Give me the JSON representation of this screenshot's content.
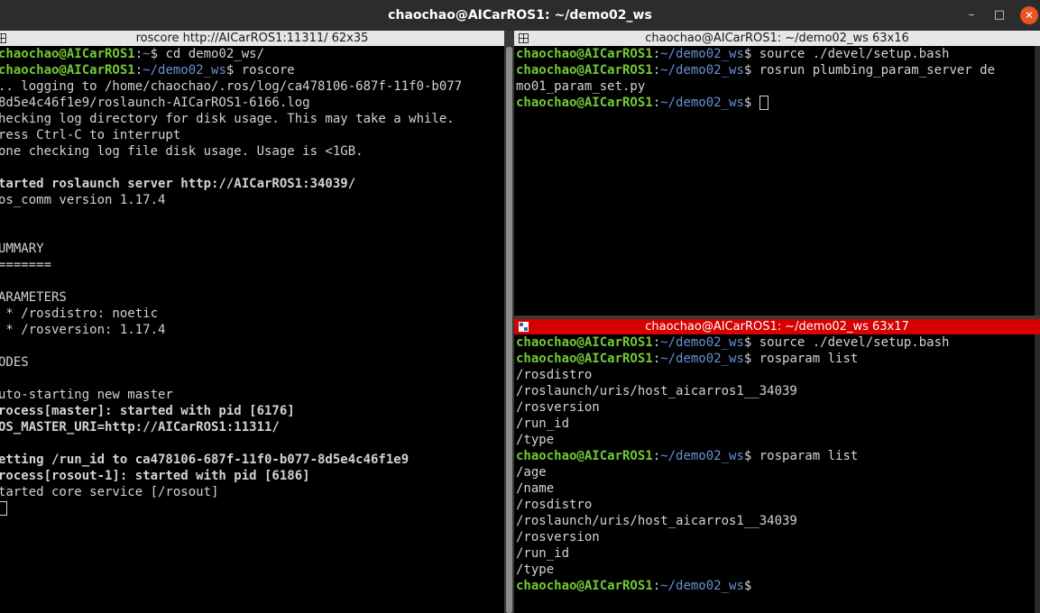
{
  "window": {
    "title": "chaochao@AICarROS1: ~/demo02_ws",
    "controls": {
      "minimize": "–",
      "maximize": "□",
      "close": "✕"
    }
  },
  "colors": {
    "titlebar": "#2c2c2c",
    "active_header": "#d60000",
    "inactive_header": "#e6e6e6",
    "prompt_user": "#73c936",
    "prompt_path": "#6b8fd3",
    "terminal_text": "#d3d3d3"
  },
  "panes": {
    "left": {
      "header": "roscore http://AICarROS1:11311/ 62x35",
      "icon": "grid-icon",
      "lines": [
        {
          "type": "prompt",
          "user": "chaochao@AICarROS1",
          "path": "~",
          "cmd": "cd demo02_ws/"
        },
        {
          "type": "prompt",
          "user": "chaochao@AICarROS1",
          "path": "~/demo02_ws",
          "cmd": "roscore"
        },
        {
          "type": "text",
          "text": ".. logging to /home/chaochao/.ros/log/ca478106-687f-11f0-b077"
        },
        {
          "type": "text",
          "text": "8d5e4c46f1e9/roslaunch-AICarROS1-6166.log"
        },
        {
          "type": "text",
          "text": "hecking log directory for disk usage. This may take a while."
        },
        {
          "type": "text",
          "text": "ress Ctrl-C to interrupt"
        },
        {
          "type": "text",
          "text": "one checking log file disk usage. Usage is <1GB."
        },
        {
          "type": "text",
          "text": ""
        },
        {
          "type": "bold",
          "text": "tarted roslaunch server http://AICarROS1:34039/"
        },
        {
          "type": "text",
          "text": "os_comm version 1.17.4"
        },
        {
          "type": "text",
          "text": ""
        },
        {
          "type": "text",
          "text": ""
        },
        {
          "type": "text",
          "text": "UMMARY"
        },
        {
          "type": "text",
          "text": "======="
        },
        {
          "type": "text",
          "text": ""
        },
        {
          "type": "text",
          "text": "ARAMETERS"
        },
        {
          "type": "text",
          "text": " * /rosdistro: noetic"
        },
        {
          "type": "text",
          "text": " * /rosversion: 1.17.4"
        },
        {
          "type": "text",
          "text": ""
        },
        {
          "type": "text",
          "text": "ODES"
        },
        {
          "type": "text",
          "text": ""
        },
        {
          "type": "text",
          "text": "uto-starting new master"
        },
        {
          "type": "bold",
          "text": "rocess[master]: started with pid [6176]"
        },
        {
          "type": "bold",
          "text": "OS_MASTER_URI=http://AICarROS1:11311/"
        },
        {
          "type": "text",
          "text": ""
        },
        {
          "type": "bold",
          "text": "etting /run_id to ca478106-687f-11f0-b077-8d5e4c46f1e9"
        },
        {
          "type": "bold",
          "text": "rocess[rosout-1]: started with pid [6186]"
        },
        {
          "type": "text",
          "text": "tarted core service [/rosout]"
        },
        {
          "type": "cursor"
        }
      ]
    },
    "top_right": {
      "header": "chaochao@AICarROS1: ~/demo02_ws 63x16",
      "icon": "grid-icon",
      "lines": [
        {
          "type": "prompt",
          "user": "chaochao@AICarROS1",
          "path": "~/demo02_ws",
          "cmd": "source ./devel/setup.bash"
        },
        {
          "type": "prompt",
          "user": "chaochao@AICarROS1",
          "path": "~/demo02_ws",
          "cmd": "rosrun plumbing_param_server de"
        },
        {
          "type": "text",
          "text": "mo01_param_set.py"
        },
        {
          "type": "prompt",
          "user": "chaochao@AICarROS1",
          "path": "~/demo02_ws",
          "cmd": "",
          "cursor": true
        }
      ]
    },
    "bottom_right": {
      "header": "chaochao@AICarROS1: ~/demo02_ws 63x17",
      "icon": "grid-icon",
      "lines": [
        {
          "type": "prompt",
          "user": "chaochao@AICarROS1",
          "path": "~/demo02_ws",
          "cmd": "source ./devel/setup.bash"
        },
        {
          "type": "prompt",
          "user": "chaochao@AICarROS1",
          "path": "~/demo02_ws",
          "cmd": "rosparam list"
        },
        {
          "type": "text",
          "text": "/rosdistro"
        },
        {
          "type": "text",
          "text": "/roslaunch/uris/host_aicarros1__34039"
        },
        {
          "type": "text",
          "text": "/rosversion"
        },
        {
          "type": "text",
          "text": "/run_id"
        },
        {
          "type": "text",
          "text": "/type"
        },
        {
          "type": "prompt",
          "user": "chaochao@AICarROS1",
          "path": "~/demo02_ws",
          "cmd": "rosparam list"
        },
        {
          "type": "text",
          "text": "/age"
        },
        {
          "type": "text",
          "text": "/name"
        },
        {
          "type": "text",
          "text": "/rosdistro"
        },
        {
          "type": "text",
          "text": "/roslaunch/uris/host_aicarros1__34039"
        },
        {
          "type": "text",
          "text": "/rosversion"
        },
        {
          "type": "text",
          "text": "/run_id"
        },
        {
          "type": "text",
          "text": "/type"
        },
        {
          "type": "prompt",
          "user": "chaochao@AICarROS1",
          "path": "~/demo02_ws",
          "cmd": ""
        }
      ]
    }
  }
}
